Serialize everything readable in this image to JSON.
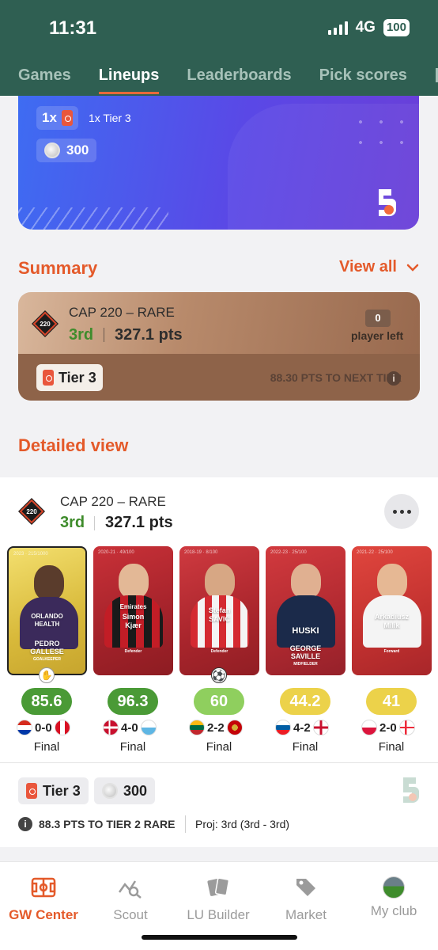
{
  "status": {
    "time": "11:31",
    "network": "4G",
    "battery": "100"
  },
  "tabs": [
    {
      "label": "Games",
      "active": false
    },
    {
      "label": "Lineups",
      "active": true
    },
    {
      "label": "Leaderboards",
      "active": false
    },
    {
      "label": "Pick scores",
      "active": false
    }
  ],
  "reward_card": {
    "multiplier": "1x",
    "tier_text": "1x Tier 3",
    "coins": "300"
  },
  "summary": {
    "title": "Summary",
    "view_all": "View all",
    "competition": "CAP 220 – RARE",
    "diamond_label": "220",
    "rank": "3rd",
    "points": "327.1 pts",
    "players_left_count": "0",
    "players_left_label": "player left",
    "tier_label": "Tier 3",
    "next_tier": "88.30 PTS TO NEXT TIER"
  },
  "detailed": {
    "title": "Detailed view",
    "competition": "CAP 220 – RARE",
    "diamond_label": "220",
    "rank": "3rd",
    "points": "327.1 pts",
    "players": [
      {
        "first": "PEDRO",
        "last": "GALLESE",
        "position": "GOALKEEPER",
        "score": "85.6",
        "score_color": "#3f8c2c",
        "score_bg": "#4a9a36",
        "score_fg": "#ffffff",
        "home_flag": "paraguay",
        "result": "0-0",
        "away_flag": "peru",
        "status": "Final",
        "sponsor1": "ORLANDO",
        "sponsor2": "HEALTH"
      },
      {
        "first": "Simon",
        "last": "Kjær",
        "position": "Defender",
        "score": "96.3",
        "score_bg": "#4a9a36",
        "score_fg": "#ffffff",
        "home_flag": "denmark",
        "result": "4-0",
        "away_flag": "san-marino",
        "status": "Final",
        "sponsor1": "Emirates",
        "sponsor2": ""
      },
      {
        "first": "Stefan",
        "last": "SAVIĆ",
        "position": "Defender",
        "score": "60",
        "score_bg": "#8fcf5e",
        "score_fg": "#ffffff",
        "home_flag": "lithuania",
        "result": "2-2",
        "away_flag": "montenegro",
        "status": "Final",
        "sponsor1": "",
        "sponsor2": ""
      },
      {
        "first": "GEORGE",
        "last": "SAVILLE",
        "position": "MIDFIELDER",
        "score": "44.2",
        "score_bg": "#ecd24a",
        "score_fg": "#ffffff",
        "home_flag": "slovenia",
        "result": "4-2",
        "away_flag": "northern-ireland",
        "status": "Final",
        "sponsor1": "HUSKI",
        "sponsor2": ""
      },
      {
        "first": "Arkadiusz",
        "last": "Milik",
        "position": "Forward",
        "score": "41",
        "score_bg": "#ecd24a",
        "score_fg": "#ffffff",
        "home_flag": "poland",
        "result": "2-0",
        "away_flag": "faroe-islands",
        "status": "Final",
        "sponsor1": "",
        "sponsor2": ""
      }
    ],
    "tier_label": "Tier 3",
    "coins": "300",
    "pts_to_tier": "88.3 PTS TO TIER 2 RARE",
    "projection": "Proj: 3rd (3rd - 3rd)"
  },
  "bottom_nav": [
    {
      "label": "GW Center",
      "icon": "pitch-icon",
      "active": true
    },
    {
      "label": "Scout",
      "icon": "scout-icon",
      "active": false
    },
    {
      "label": "LU Builder",
      "icon": "cards-icon",
      "active": false
    },
    {
      "label": "Market",
      "icon": "tag-icon",
      "active": false
    },
    {
      "label": "My club",
      "icon": "club-avatar-icon",
      "active": false
    }
  ],
  "colors": {
    "header": "#2f5f52",
    "accent": "#e45a2a",
    "rank_green": "#3f8c2c"
  }
}
